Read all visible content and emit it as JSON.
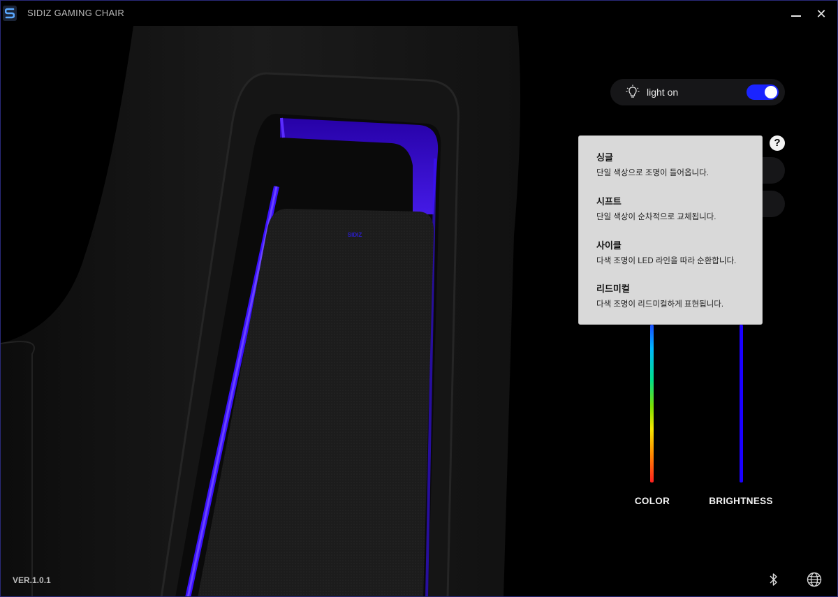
{
  "app": {
    "title": "SIDIZ GAMING CHAIR",
    "version": "VER.1.0.1"
  },
  "chair": {
    "logo_text": "SIDIZ",
    "led_color": "#3a10ff"
  },
  "light": {
    "label": "light on",
    "toggle_on": true,
    "accent": "#1a24ff"
  },
  "help": {
    "label": "?"
  },
  "tooltip": {
    "items": [
      {
        "title": "싱글",
        "desc": "단일 색상으로 조명이 들어옵니다."
      },
      {
        "title": "시프트",
        "desc": "단일 색상이 순차적으로 교체됩니다."
      },
      {
        "title": "사이클",
        "desc": "다색 조명이 LED 라인을 따라 순환합니다."
      },
      {
        "title": "리드미컬",
        "desc": "다색 조명이 리드미컬하게 표현됩니다."
      }
    ]
  },
  "sliders": {
    "color_label": "COLOR",
    "brightness_label": "BRIGHTNESS"
  },
  "icons": {
    "bulb": "bulb-icon",
    "bluetooth": "bluetooth-icon",
    "globe": "globe-icon",
    "minimize": "minimize-icon",
    "close": "close-icon"
  }
}
